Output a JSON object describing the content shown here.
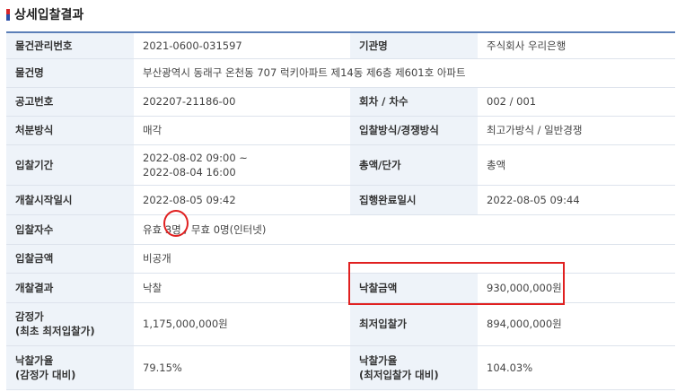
{
  "section_title": "상세입찰결과",
  "rows": [
    {
      "l1": "물건관리번호",
      "v1": "2021-0600-031597",
      "l2": "기관명",
      "v2": "주식회사 우리은행"
    },
    {
      "l1": "물건명",
      "v1": "부산광역시 동래구 온천동 707 럭키아파트 제14동 제6층 제601호 아파트"
    },
    {
      "l1": "공고번호",
      "v1": "202207-21186-00",
      "l2": "회차 / 차수",
      "v2": "002 / 001"
    },
    {
      "l1": "처분방식",
      "v1": "매각",
      "l2": "입찰방식/경쟁방식",
      "v2": "최고가방식 / 일반경쟁"
    },
    {
      "l1": "입찰기간",
      "v1a": "2022-08-02 09:00 ~",
      "v1b": "2022-08-04 16:00",
      "l2": "총액/단가",
      "v2": "총액"
    },
    {
      "l1": "개찰시작일시",
      "v1": "2022-08-05 09:42",
      "l2": "집행완료일시",
      "v2": "2022-08-05 09:44"
    },
    {
      "l1": "입찰자수",
      "v1": "유효 3명 / 무효 0명(인터넷)"
    },
    {
      "l1": "입찰금액",
      "v1": "비공개"
    },
    {
      "l1": "개찰결과",
      "v1": "낙찰",
      "l2": "낙찰금액",
      "v2": "930,000,000원"
    },
    {
      "l1a": "감정가",
      "l1b": "(최초 최저입찰가)",
      "v1": "1,175,000,000원",
      "l2": "최저입찰가",
      "v2": "894,000,000원"
    },
    {
      "l1a": "낙찰가율",
      "l1b": "(감정가 대비)",
      "v1": "79.15%",
      "l2a": "낙찰가율",
      "l2b": "(최저입찰가 대비)",
      "v2": "104.03%"
    }
  ],
  "colors": {
    "header_line": "#5b7fb8",
    "label_bg": "#eef3f9",
    "annotation": "#e02020",
    "title_mark_red": "#d6262b",
    "title_mark_blue": "#2b4fa8"
  }
}
